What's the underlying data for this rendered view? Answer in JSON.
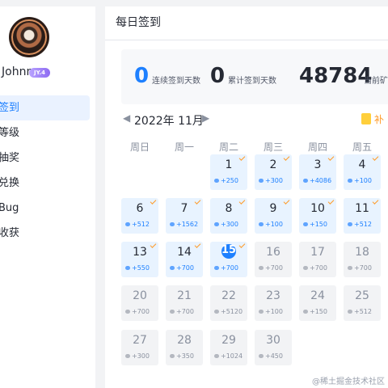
{
  "user": {
    "name": "Johnn",
    "level": "JY.4"
  },
  "nav": [
    {
      "label": "签到",
      "active": true
    },
    {
      "label": "等级",
      "active": false
    },
    {
      "label": "抽奖",
      "active": false
    },
    {
      "label": "兑换",
      "active": false
    },
    {
      "label": "Bug",
      "active": false
    },
    {
      "label": "收获",
      "active": false
    }
  ],
  "main": {
    "title": "每日签到"
  },
  "stats": {
    "consecutive_value": "0",
    "consecutive_label": "连续签到天数",
    "total_value": "0",
    "total_label": "累计签到天数",
    "ore_value": "48784",
    "ore_label": "当前矿"
  },
  "calendar": {
    "month": "2022年 11月",
    "makeup_label": "补",
    "weekdays": [
      "周日",
      "周一",
      "周二",
      "周三",
      "周四",
      "周五"
    ],
    "days": [
      {
        "day": "1",
        "points": "+250",
        "signed": true,
        "col": 2,
        "row": 0
      },
      {
        "day": "2",
        "points": "+300",
        "signed": true,
        "col": 3,
        "row": 0
      },
      {
        "day": "3",
        "points": "+4086",
        "signed": true,
        "col": 4,
        "row": 0
      },
      {
        "day": "4",
        "points": "+100",
        "signed": true,
        "col": 5,
        "row": 0
      },
      {
        "day": "6",
        "points": "+512",
        "signed": true,
        "col": 0,
        "row": 1
      },
      {
        "day": "7",
        "points": "+1562",
        "signed": true,
        "col": 1,
        "row": 1
      },
      {
        "day": "8",
        "points": "+300",
        "signed": true,
        "col": 2,
        "row": 1
      },
      {
        "day": "9",
        "points": "+100",
        "signed": true,
        "col": 3,
        "row": 1
      },
      {
        "day": "10",
        "points": "+150",
        "signed": true,
        "col": 4,
        "row": 1
      },
      {
        "day": "11",
        "points": "+512",
        "signed": true,
        "col": 5,
        "row": 1
      },
      {
        "day": "13",
        "points": "+550",
        "signed": true,
        "col": 0,
        "row": 2
      },
      {
        "day": "14",
        "points": "+700",
        "signed": true,
        "col": 1,
        "row": 2
      },
      {
        "day": "15",
        "points": "+700",
        "signed": true,
        "today": true,
        "col": 2,
        "row": 2
      },
      {
        "day": "16",
        "points": "+700",
        "signed": false,
        "col": 3,
        "row": 2
      },
      {
        "day": "17",
        "points": "+700",
        "signed": false,
        "col": 4,
        "row": 2
      },
      {
        "day": "18",
        "points": "+700",
        "signed": false,
        "col": 5,
        "row": 2
      },
      {
        "day": "20",
        "points": "+700",
        "signed": false,
        "col": 0,
        "row": 3
      },
      {
        "day": "21",
        "points": "+700",
        "signed": false,
        "col": 1,
        "row": 3
      },
      {
        "day": "22",
        "points": "+5120",
        "signed": false,
        "col": 2,
        "row": 3
      },
      {
        "day": "23",
        "points": "+100",
        "signed": false,
        "col": 3,
        "row": 3
      },
      {
        "day": "24",
        "points": "+150",
        "signed": false,
        "col": 4,
        "row": 3
      },
      {
        "day": "25",
        "points": "+512",
        "signed": false,
        "col": 5,
        "row": 3
      },
      {
        "day": "27",
        "points": "+300",
        "signed": false,
        "col": 0,
        "row": 4
      },
      {
        "day": "28",
        "points": "+350",
        "signed": false,
        "col": 1,
        "row": 4
      },
      {
        "day": "29",
        "points": "+1024",
        "signed": false,
        "col": 2,
        "row": 4
      },
      {
        "day": "30",
        "points": "+450",
        "signed": false,
        "col": 3,
        "row": 4
      }
    ]
  },
  "watermark": "@稀土掘金技术社区",
  "colors": {
    "accent": "#1e80ff",
    "check": "#ff9b28",
    "signed_bg": "#e8f3ff"
  }
}
